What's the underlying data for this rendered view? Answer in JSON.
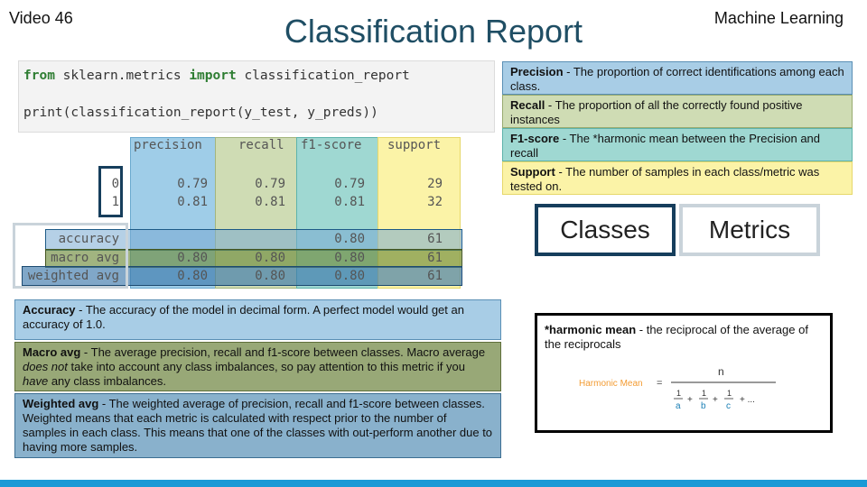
{
  "header": {
    "video_label": "Video 46",
    "title": "Classification Report",
    "series_label": "Machine Learning"
  },
  "code": {
    "line1_kw1": "from",
    "line1_mid": " sklearn.metrics ",
    "line1_kw2": "import",
    "line1_end": " classification_report",
    "line2": "print(classification_report(y_test, y_preds))"
  },
  "report": {
    "headers": [
      "precision",
      "recall",
      "f1-score",
      "support"
    ],
    "class_rows": [
      {
        "label": "0",
        "values": [
          "0.79",
          "0.79",
          "0.79",
          "29"
        ]
      },
      {
        "label": "1",
        "values": [
          "0.81",
          "0.81",
          "0.81",
          "32"
        ]
      }
    ],
    "accuracy": {
      "label": "accuracy",
      "f1": "0.80",
      "support": "61"
    },
    "macro": {
      "label": "macro avg",
      "values": [
        "0.80",
        "0.80",
        "0.80",
        "61"
      ]
    },
    "weighted": {
      "label": "weighted avg",
      "values": [
        "0.80",
        "0.80",
        "0.80",
        "61"
      ]
    }
  },
  "definitions": {
    "precision": {
      "term": "Precision",
      "text": " - The proportion of correct identifications among each class."
    },
    "recall": {
      "term": "Recall",
      "text": " - The proportion of all the correctly found positive instances"
    },
    "f1": {
      "term": "F1-score",
      "text": " - The *harmonic mean between the Precision and recall"
    },
    "support": {
      "term": "Support",
      "text": " - The number of samples in each class/metric was tested on."
    }
  },
  "buttons": {
    "classes": "Classes",
    "metrics": "Metrics"
  },
  "notes": {
    "accuracy": {
      "term": "Accuracy",
      "text": " - The accuracy of the model in decimal form. A perfect model would get an accuracy of 1.0."
    },
    "macro": {
      "term": "Macro avg",
      "text1": " - The average precision, recall and f1-score between classes. Macro average ",
      "em1": "does not",
      "text2": " take into account any class imbalances, so pay attention to this metric if you ",
      "em2": "have",
      "text3": " any class imbalances."
    },
    "weighted": {
      "term": "Weighted avg",
      "text1": " - The weighted average of precision, recall and f1-score between classes. Weighted means that each metric is calculated with respect prior to the number of samples in each class. This means that one of the classes with out-perform another due to having more samples."
    }
  },
  "harmonic": {
    "term": "*harmonic mean",
    "text": " - the reciprocal of the average of the reciprocals",
    "formula_label": "Harmonic Mean",
    "equals": "=",
    "numerator": "n",
    "one": "1",
    "a": "a",
    "b": "b",
    "c": "c",
    "plus": "+",
    "dots": "+ ...",
    "label_color": "#f39c34",
    "letter_color": "#1a7fb5"
  },
  "colors": {
    "precision_col": "#9fcde8",
    "recall_col": "#cfdcb4",
    "f1_col": "#9fd8d2",
    "support_col": "#fbf3a7",
    "navy": "#163e5c",
    "bar": "#1a9ad6"
  }
}
